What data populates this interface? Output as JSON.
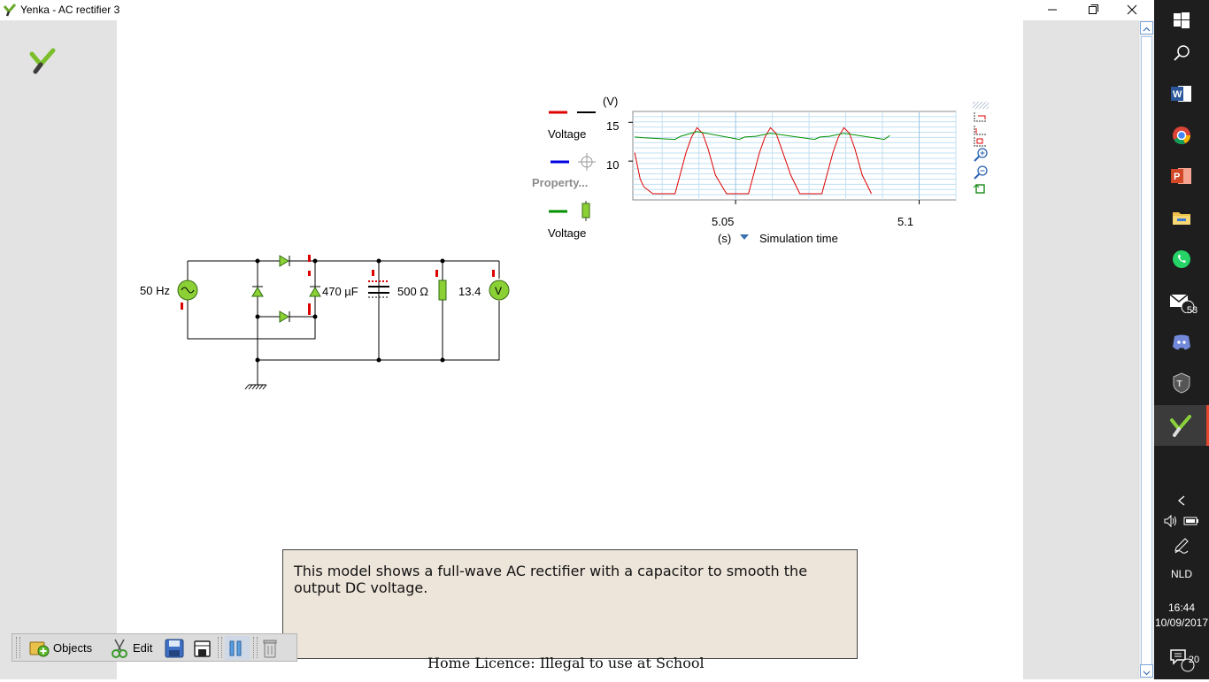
{
  "window": {
    "title": "Yenka - AC rectifier 3"
  },
  "graph": {
    "y_unit": "(V)",
    "y_ticks": [
      "15",
      "10"
    ],
    "x_ticks": [
      "5.05",
      "5.1"
    ],
    "x_unit": "(s)",
    "x_axis_label": "Simulation time",
    "legend": [
      {
        "label": "Voltage",
        "colors": [
          "#e00000",
          "#000000"
        ]
      },
      {
        "label": "Property...",
        "colors": [
          "#0000e0"
        ]
      },
      {
        "label": "Voltage",
        "colors": [
          "#009000"
        ]
      }
    ]
  },
  "chart_data": {
    "type": "line",
    "xlim": [
      5.022,
      5.11
    ],
    "ylim": [
      5,
      16.4
    ],
    "x_ticks": [
      5.05,
      5.1
    ],
    "y_ticks": [
      10,
      15
    ],
    "grid": true,
    "series": [
      {
        "name": "Voltage",
        "color": "#e00000",
        "x": [
          5.0225,
          5.024,
          5.025,
          5.02745,
          5.0315,
          5.0335,
          5.0365,
          5.038,
          5.0395,
          5.041,
          5.0425,
          5.0445,
          5.0475,
          5.0515,
          5.0535,
          5.0565,
          5.058,
          5.0595,
          5.061,
          5.0625,
          5.065,
          5.0675,
          5.0715,
          5.0735,
          5.0765,
          5.078,
          5.0795,
          5.081,
          5.0825,
          5.0845,
          5.087
        ],
        "y": [
          11.1,
          7.7,
          6.7,
          5.8,
          5.8,
          5.8,
          11.1,
          13.1,
          14.3,
          13.6,
          11.6,
          8.2,
          5.8,
          5.8,
          5.8,
          11.1,
          13.1,
          14.3,
          13.6,
          11.6,
          8.2,
          5.8,
          5.8,
          5.8,
          11.1,
          13.1,
          14.3,
          13.6,
          11.6,
          8.2,
          5.8
        ]
      },
      {
        "name": "Voltage",
        "color": "#009000",
        "x": [
          5.0225,
          5.025,
          5.0335,
          5.035,
          5.0395,
          5.051,
          5.0525,
          5.0555,
          5.0595,
          5.0715,
          5.073,
          5.0755,
          5.0795,
          5.0905,
          5.092
        ],
        "y": [
          13.1,
          13,
          12.8,
          13.2,
          13.8,
          12.8,
          13.1,
          13.2,
          13.6,
          12.8,
          13.1,
          13.2,
          13.6,
          12.8,
          13.3
        ]
      }
    ]
  },
  "circuit": {
    "source_label": "50 Hz",
    "capacitor_label": "470 µF",
    "resistor_label": "500 Ω",
    "voltmeter_reading": "13.4",
    "voltmeter_symbol": "V"
  },
  "info": {
    "text": "This model shows a full-wave AC rectifier with a capacitor to smooth the output DC voltage."
  },
  "licence": "Home Licence: Illegal to use at School",
  "toolbar": {
    "objects_label": "Objects",
    "edit_label": "Edit"
  },
  "taskbar": {
    "mail_badge": "53",
    "language": "NLD",
    "time": "16:44",
    "date": "10/09/2017",
    "notification_count": "20"
  }
}
